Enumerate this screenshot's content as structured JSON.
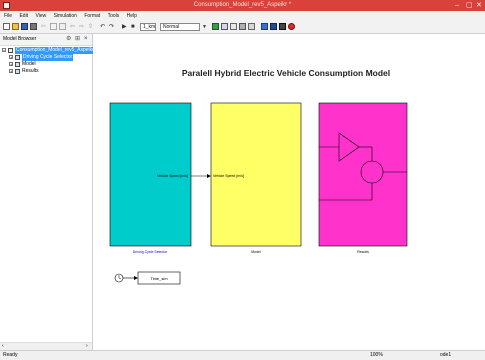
{
  "window": {
    "title": "Consumption_Model_rev5_Aspeikr *",
    "controls": [
      "–",
      "▢",
      "✕"
    ]
  },
  "menu": [
    "File",
    "Edit",
    "View",
    "Simulation",
    "Format",
    "Tools",
    "Help"
  ],
  "toolbar": {
    "stop_time": "1_km",
    "mode": "Normal"
  },
  "browser": {
    "title": "Model Browser",
    "items": [
      {
        "label": "Consumption_Model_rev5_Aspeikr",
        "selected": true
      },
      {
        "label": "Driving Cycle Selector",
        "selected": true
      },
      {
        "label": "Model",
        "selected": false
      },
      {
        "label": "Results",
        "selected": false
      }
    ]
  },
  "diagram": {
    "title": "Paralell Hybrid Electric Vehicle Consumption Model",
    "blocks": {
      "driving_cycle": {
        "label": "Driving Cycle Selector",
        "port_label": "Vehicle Speed [m/s]",
        "color": "#00cccc"
      },
      "model": {
        "label": "Model",
        "port_label": "Vehicle Speed [m/s]",
        "color": "#ffff66"
      },
      "results": {
        "label": "Results",
        "color": "#ff33cc"
      }
    },
    "clock_block": {
      "output_label": "Time_sim"
    }
  },
  "status": {
    "text": "Ready",
    "zoom": "100%",
    "solver": "ode1"
  },
  "colors": {
    "titlebar": "#d9413a",
    "selection": "#3399ff",
    "link_label": "#0000cc"
  }
}
